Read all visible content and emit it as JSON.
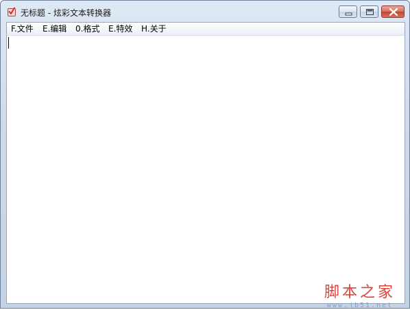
{
  "window": {
    "title": "无标题 - 炫彩文本转换器"
  },
  "menubar": {
    "items": [
      {
        "label": "F.文件"
      },
      {
        "label": "E.编辑"
      },
      {
        "label": "0.格式"
      },
      {
        "label": "E.特效"
      },
      {
        "label": "H.关于"
      }
    ]
  },
  "editor": {
    "content": ""
  },
  "watermark": {
    "brand": "脚本之家",
    "url": "www.jb51.net"
  },
  "icons": {
    "app": "app-icon",
    "minimize": "minimize-icon",
    "maximize": "maximize-icon",
    "close": "close-icon"
  },
  "colors": {
    "watermark_brand": "#e2413a",
    "watermark_url": "#8aa0c8",
    "close_button": "#c5432f"
  }
}
